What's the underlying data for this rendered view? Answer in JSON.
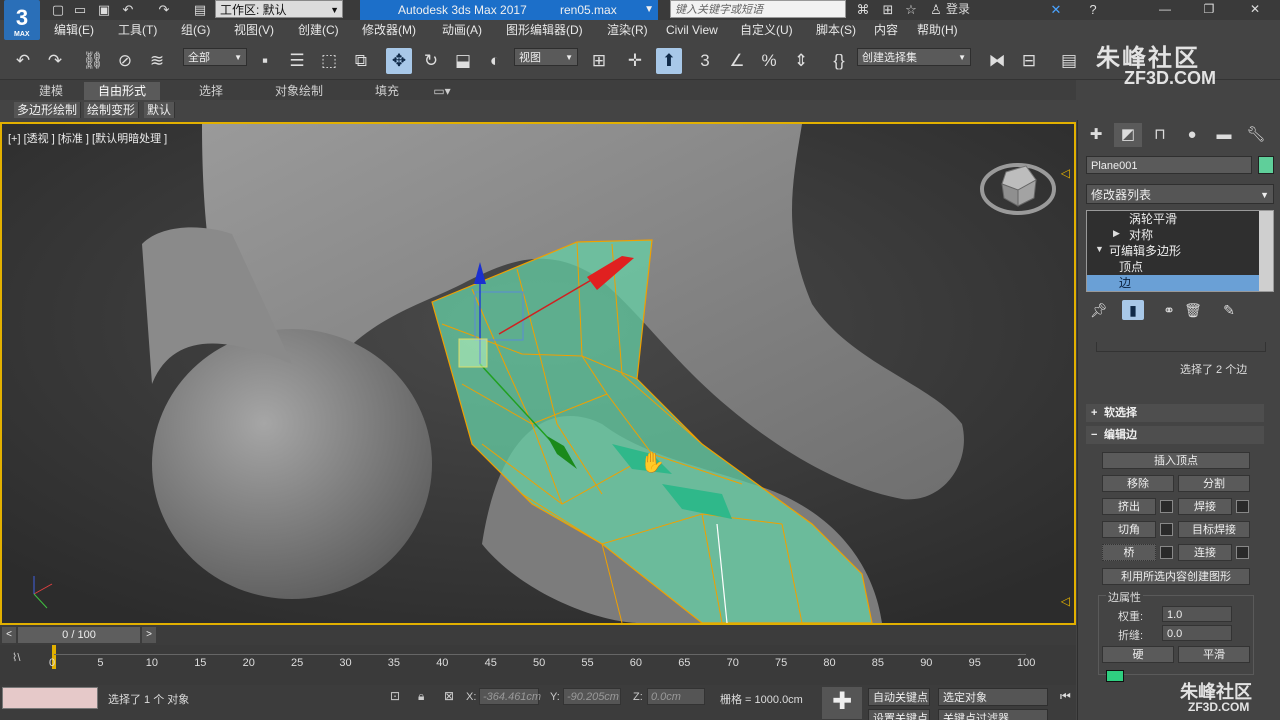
{
  "titlebar": {
    "logo_text": "3",
    "logo_sub": "MAX",
    "workspace_label": "工作区: 默认",
    "app_title": "Autodesk 3ds Max 2017",
    "file_name": "ren05.max",
    "search_placeholder": "键入关键字或短语",
    "login_label": "登录"
  },
  "menu": {
    "items": [
      "编辑(E)",
      "工具(T)",
      "组(G)",
      "视图(V)",
      "创建(C)",
      "修改器(M)",
      "动画(A)",
      "图形编辑器(D)",
      "渲染(R)",
      "Civil View",
      "自定义(U)",
      "脚本(S)",
      "内容",
      "帮助(H)"
    ]
  },
  "toolbar": {
    "selection_filter": "全部",
    "ref_coord": "视图",
    "named_selection": "创建选择集"
  },
  "ribbon": {
    "tabs": [
      "建模",
      "自由形式",
      "选择",
      "对象绘制",
      "填充"
    ],
    "subtabs": [
      "多边形绘制",
      "绘制变形",
      "默认"
    ]
  },
  "viewport": {
    "label": "[+] [透视 ] [标准 ] [默认明暗处理 ]"
  },
  "timeline": {
    "frame_display": "0 / 100",
    "ticks": [
      "0",
      "5",
      "10",
      "15",
      "20",
      "25",
      "30",
      "35",
      "40",
      "45",
      "50",
      "55",
      "60",
      "65",
      "70",
      "75",
      "80",
      "85",
      "90",
      "95",
      "100"
    ]
  },
  "status": {
    "message": "选择了 1 个 对象",
    "x_label": "X:",
    "x_value": "-364.461cm",
    "y_label": "Y:",
    "y_value": "-90.205cm",
    "z_label": "Z:",
    "z_value": "0.0cm",
    "grid": "栅格 = 1000.0cm",
    "auto_key": "自动关键点",
    "selected_object": "选定对象",
    "set_key": "设置关键点",
    "key_filters": "关键点过滤器"
  },
  "command_panel": {
    "object_name": "Plane001",
    "object_color": "#5fcf9a",
    "modifier_list": "修改器列表",
    "stack": [
      "涡轮平滑",
      "对称",
      "可编辑多边形",
      "顶点",
      "边"
    ],
    "selection_info": "选择了 2 个边",
    "soft_selection": "软选择",
    "edit_edges": "编辑边",
    "buttons": {
      "insert_vertex": "插入顶点",
      "remove": "移除",
      "split": "分割",
      "extrude": "挤出",
      "weld": "焊接",
      "chamfer": "切角",
      "target_weld": "目标焊接",
      "bridge": "桥",
      "connect": "连接",
      "create_shape": "利用所选内容创建图形"
    },
    "edge_properties": "边属性",
    "weight_label": "权重:",
    "weight_value": "1.0",
    "crease_label": "折缝:",
    "crease_value": "0.0",
    "hard": "硬",
    "smooth": "平滑"
  },
  "watermarks": {
    "top_brand": "朱峰社区",
    "top_url": "ZF3D.COM",
    "bottom_brand": "朱峰社区",
    "bottom_url": "ZF3D.COM"
  },
  "colors": {
    "title_blue": "#1c6fc9",
    "viewport_border": "#e2b000",
    "selection_green": "#5fcf9a",
    "stack_selected": "#6aa0d6"
  }
}
